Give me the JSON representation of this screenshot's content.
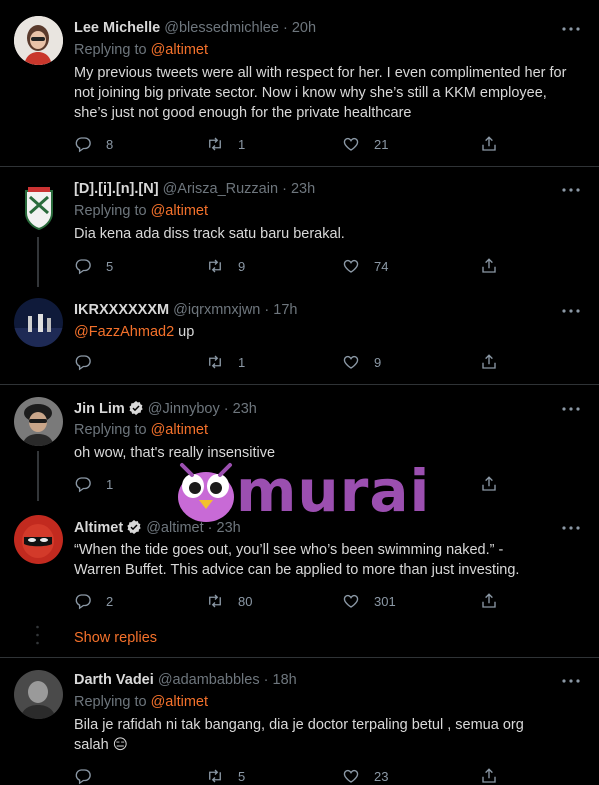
{
  "tweets": [
    {
      "name": "Lee Michelle",
      "handle": "@blessedmichlee",
      "time": "20h",
      "replying_prefix": "Replying to",
      "replying_to": "@altimet",
      "text": "My previous tweets were all with respect for her. I even complimented her for not joining big private sector. Now i know why she’s still a KKM employee, she’s just not good enough for the private healthcare",
      "replies": "8",
      "retweets": "1",
      "likes": "21"
    },
    {
      "name": "[D].[i].[n].[N]",
      "handle": "@Arisza_Ruzzain",
      "time": "23h",
      "replying_prefix": "Replying to",
      "replying_to": "@altimet",
      "text": "Dia kena ada diss track satu baru berakal.",
      "replies": "5",
      "retweets": "9",
      "likes": "74"
    },
    {
      "name": "IKRXXXXXXM",
      "handle": "@iqrxmnxjwn",
      "time": "17h",
      "mention": "@FazzAhmad2",
      "text": " up",
      "replies": "",
      "retweets": "1",
      "likes": "9"
    },
    {
      "name": "Jin Lim",
      "handle": "@Jinnyboy",
      "time": "23h",
      "replying_prefix": "Replying to",
      "replying_to": "@altimet",
      "text": "oh wow, that's really insensitive",
      "replies": "1",
      "retweets": "",
      "likes": ""
    },
    {
      "name": "Altimet",
      "handle": "@altimet",
      "time": "23h",
      "text_line1": "“When the tide goes out, you’ll see who’s been swimming naked.” -",
      "text_line2": "Warren Buffet. This advice can be applied to more than just investing.",
      "replies": "2",
      "retweets": "80",
      "likes": "301"
    },
    {
      "name": "Darth Vadei",
      "handle": "@adambabbles",
      "time": "18h",
      "replying_prefix": "Replying to",
      "replying_to": "@altimet",
      "text_line1": "Bila je rafidah ni tak bangang, dia je doctor terpaling betul , semua org",
      "text_line2": "salah",
      "emoji": "😑",
      "replies": "",
      "retweets": "5",
      "likes": "23"
    }
  ],
  "show_replies": "Show replies",
  "sep": "·",
  "watermark": {
    "text": "murai",
    "color": "#9b4fb0"
  },
  "colors": {
    "accent": "#f4712b",
    "bg": "#000000",
    "muted": "#6e767d",
    "divider": "#2f3336"
  }
}
